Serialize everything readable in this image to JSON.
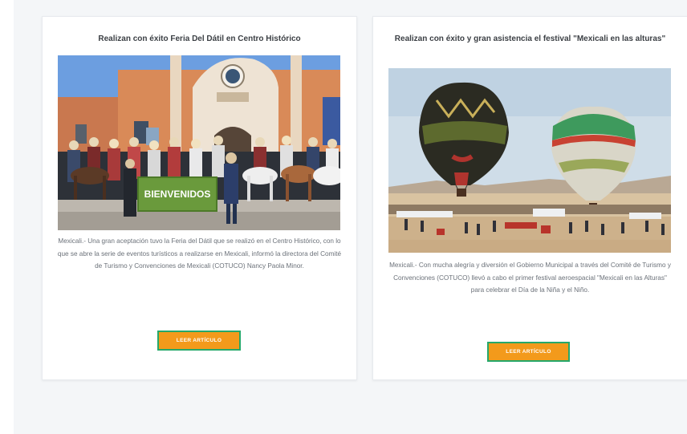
{
  "articles": [
    {
      "title": "Realizan con éxito Feria Del Dátil en Centro Histórico",
      "banner": "BIENVENIDOS",
      "excerpt": "Mexicali.- Una gran aceptación tuvo la Feria del Dátil que se realizó en el Centro Histórico, con lo que se abre la serie de eventos turísticos a realizarse en Mexicali, informó la directora del Comité de Turismo y Convenciones de Mexicali (COTUCO) Nancy Paola Minor.",
      "button_label": "LEER ARTÍCULO"
    },
    {
      "title": "Realizan con éxito y gran asistencia el festival \"Mexicali en las alturas\"",
      "excerpt": "Mexicali.- Con mucha alegría y diversión el Gobierno Municipal a través del Comité de Turismo y Convenciones (COTUCO) llevó a cabo el primer festival aeroespacial \"Mexicali en las Alturas\" para celebrar el Día de la Niña y el Niño.",
      "button_label": "LEER ARTÍCULO"
    }
  ],
  "colors": {
    "button_fill": "#f39a1b",
    "button_border": "#25a86a",
    "panel_bg": "#f4f6f8"
  }
}
